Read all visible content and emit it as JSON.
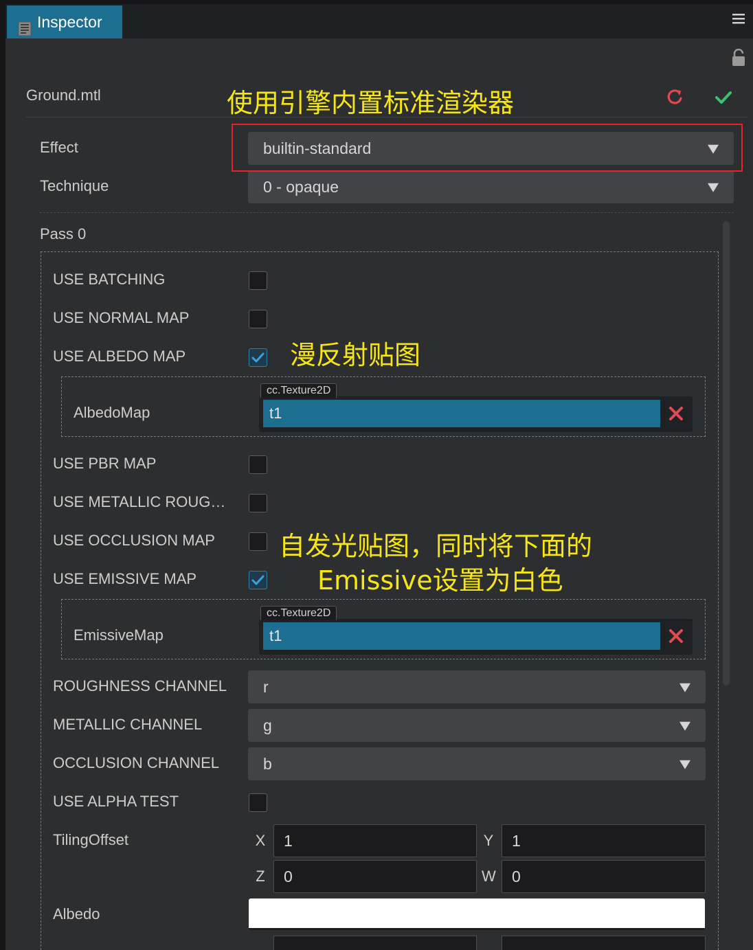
{
  "window": {
    "tab_title": "Inspector",
    "tab_icon": "inspector-icon",
    "menu_icon": "hamburger-menu-icon",
    "lock_icon": "unlock-icon"
  },
  "asset": {
    "name": "Ground.mtl",
    "revert_icon": "revert-icon",
    "apply_icon": "check-icon",
    "revert_color": "#e14953",
    "apply_color": "#3cc16e"
  },
  "effect": {
    "label": "Effect",
    "value": "builtin-standard"
  },
  "technique": {
    "label": "Technique",
    "value": "0 - opaque"
  },
  "pass": {
    "title": "Pass 0",
    "use_batching": {
      "label": "USE BATCHING",
      "checked": false
    },
    "use_normal_map": {
      "label": "USE NORMAL MAP",
      "checked": false
    },
    "use_albedo_map": {
      "label": "USE ALBEDO MAP",
      "checked": true
    },
    "albedo_map": {
      "label": "AlbedoMap",
      "type": "cc.Texture2D",
      "value": "t1"
    },
    "use_pbr_map": {
      "label": "USE PBR MAP",
      "checked": false
    },
    "use_metallic_roughness": {
      "label": "USE METALLIC ROUG…",
      "checked": false
    },
    "use_occlusion_map": {
      "label": "USE OCCLUSION MAP",
      "checked": false
    },
    "use_emissive_map": {
      "label": "USE EMISSIVE MAP",
      "checked": true
    },
    "emissive_map": {
      "label": "EmissiveMap",
      "type": "cc.Texture2D",
      "value": "t1"
    },
    "roughness_channel": {
      "label": "ROUGHNESS CHANNEL",
      "value": "r"
    },
    "metallic_channel": {
      "label": "METALLIC CHANNEL",
      "value": "g"
    },
    "occlusion_channel": {
      "label": "OCCLUSION CHANNEL",
      "value": "b"
    },
    "use_alpha_test": {
      "label": "USE ALPHA TEST",
      "checked": false
    },
    "tiling_offset": {
      "label": "TilingOffset",
      "x_label": "X",
      "x": "1",
      "y_label": "Y",
      "y": "1",
      "z_label": "Z",
      "z": "0",
      "w_label": "W",
      "w": "0"
    },
    "albedo": {
      "label": "Albedo",
      "color": "#ffffff"
    }
  },
  "annotations": {
    "effect_note": "使用引擎内置标准渲染器",
    "albedo_note": "漫反射贴图",
    "emissive_note_line1": "自发光贴图，同时将下面的",
    "emissive_note_line2": "Emissive设置为白色",
    "color": "#f6e51a",
    "highlight_color": "#e8222a"
  },
  "colors": {
    "accent": "#1d6f92",
    "panel_bg": "#2d2e30",
    "field_bg": "#424347"
  }
}
